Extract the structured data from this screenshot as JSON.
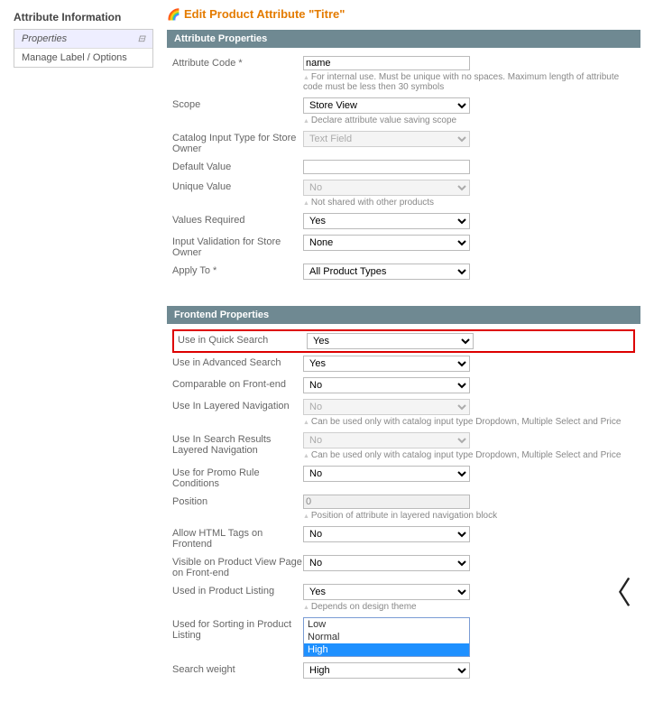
{
  "sidebar": {
    "title": "Attribute Information",
    "items": [
      {
        "label": "Properties",
        "active": true
      },
      {
        "label": "Manage Label / Options",
        "active": false
      }
    ]
  },
  "page": {
    "title": "Edit Product Attribute \"Titre\""
  },
  "sections": {
    "attr_props": {
      "title": "Attribute Properties",
      "attribute_code_label": "Attribute Code *",
      "attribute_code_value": "name",
      "attribute_code_hint": "For internal use. Must be unique with no spaces. Maximum length of attribute code must be less then 30 symbols",
      "scope_label": "Scope",
      "scope_value": "Store View",
      "scope_hint": "Declare attribute value saving scope",
      "catalog_input_label": "Catalog Input Type for Store Owner",
      "catalog_input_value": "Text Field",
      "default_value_label": "Default Value",
      "default_value_value": "",
      "unique_label": "Unique Value",
      "unique_value": "No",
      "unique_hint": "Not shared with other products",
      "required_label": "Values Required",
      "required_value": "Yes",
      "validation_label": "Input Validation for Store Owner",
      "validation_value": "None",
      "apply_label": "Apply To *",
      "apply_value": "All Product Types"
    },
    "frontend": {
      "title": "Frontend Properties",
      "quick_search_label": "Use in Quick Search",
      "quick_search_value": "Yes",
      "adv_search_label": "Use in Advanced Search",
      "adv_search_value": "Yes",
      "comparable_label": "Comparable on Front-end",
      "comparable_value": "No",
      "layered_label": "Use In Layered Navigation",
      "layered_value": "No",
      "layered_hint": "Can be used only with catalog input type Dropdown, Multiple Select and Price",
      "search_layered_label": "Use In Search Results Layered Navigation",
      "search_layered_value": "No",
      "search_layered_hint": "Can be used only with catalog input type Dropdown, Multiple Select and Price",
      "promo_label": "Use for Promo Rule Conditions",
      "promo_value": "No",
      "position_label": "Position",
      "position_value": "0",
      "position_hint": "Position of attribute in layered navigation block",
      "allow_html_label": "Allow HTML Tags on Frontend",
      "allow_html_value": "No",
      "visible_pv_label": "Visible on Product View Page on Front-end",
      "visible_pv_value": "No",
      "used_listing_label": "Used in Product Listing",
      "used_listing_value": "Yes",
      "used_listing_hint": "Depends on design theme",
      "used_sorting_label": "Used for Sorting in Product Listing",
      "sorting_options": [
        "Low",
        "Normal",
        "High"
      ],
      "sorting_selected": "High",
      "search_weight_label": "Search weight",
      "search_weight_value": "High"
    }
  }
}
